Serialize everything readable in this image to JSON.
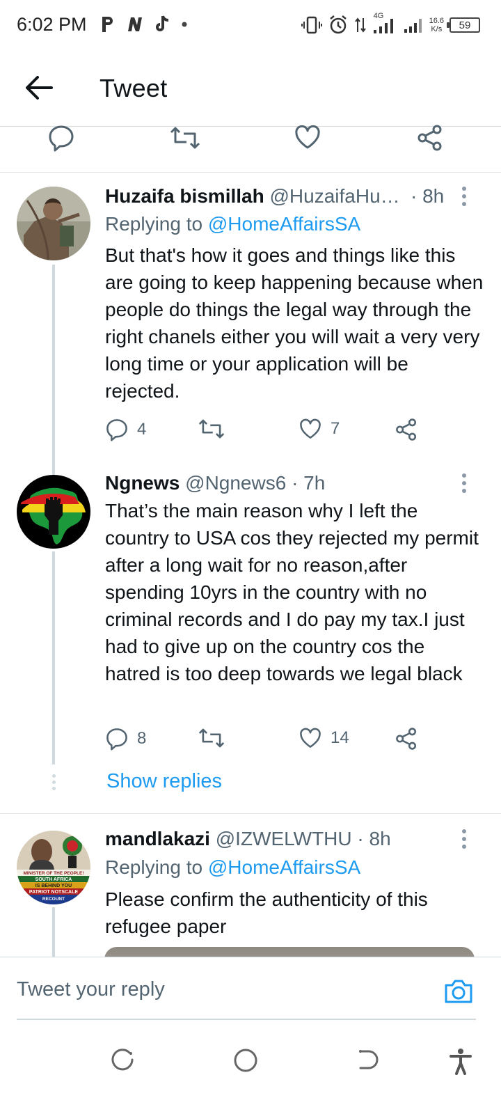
{
  "status_bar": {
    "time": "6:02 PM",
    "left_icons": [
      "p-icon",
      "n-icon",
      "tiktok-icon",
      "dot-icon"
    ],
    "network": "4G",
    "speed_value": "16.6",
    "speed_unit": "K/s",
    "battery": "59"
  },
  "header": {
    "title": "Tweet"
  },
  "tweets": [
    {
      "name": "Huzaifa bismillah",
      "handle": "@HuzaifaHu…",
      "time": "· 8h",
      "replying_label": "Replying to",
      "replying_to": "@HomeAffairsSA",
      "text": "But that's how it goes and things like this are going to keep happening because when people do things the legal way through the right chanels either you will wait a very very long time or your application will be rejected.",
      "replies": "4",
      "retweets": "",
      "likes": "7"
    },
    {
      "name": "Ngnews",
      "handle": "@Ngnews6 · 7h",
      "text": "That’s the main reason why I left the country to USA cos they rejected my permit after a long wait for no reason,after spending 10yrs in the country with no criminal records and I do pay my tax.I just had to give up on the country cos the hatred is too deep towards we legal black",
      "replies": "8",
      "retweets": "",
      "likes": "14"
    },
    {
      "name": "mandlakazi",
      "handle": "@IZWELWTHU · 8h",
      "replying_label": "Replying to",
      "replying_to": "@HomeAffairsSA",
      "text": "Please confirm the authenticity of this refugee paper"
    }
  ],
  "show_replies": "Show replies",
  "avatar3_text": {
    "line1": "MINISTER OF THE PEOPLE!",
    "line2": "SOUTH AFRICA",
    "line3": "IS BEHIND YOU",
    "line4": "PATRIOT NOTSCALE",
    "line5": "RECOUNT"
  },
  "compose": {
    "placeholder": "Tweet your reply"
  },
  "colors": {
    "accent": "#1d9bf0",
    "text": "#0f1419",
    "secondary": "#536471",
    "thread": "#cfd9de"
  }
}
